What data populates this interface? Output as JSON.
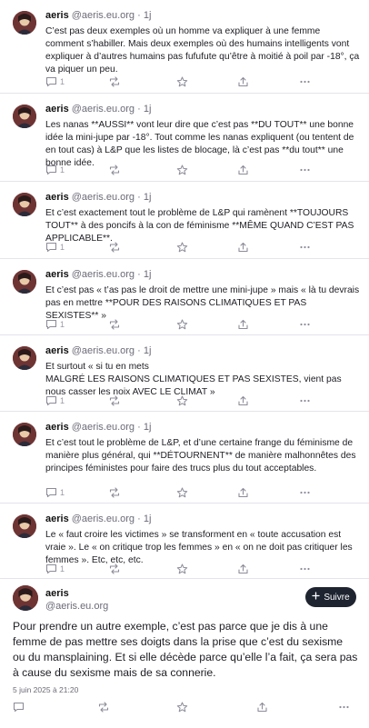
{
  "posts": [
    {
      "name": "aeris",
      "handle": "@aeris.eu.org",
      "dot": "·",
      "age": "1j",
      "text": "C’est pas deux exemples où un homme va expliquer à une femme comment s’habiller. Mais deux exemples où des humains intelligents vont expliquer à d’autres humains pas fufufute qu’être à moitié à poil par -18°, ça va piquer un peu.",
      "reply_count": "1"
    },
    {
      "name": "aeris",
      "handle": "@aeris.eu.org",
      "dot": "·",
      "age": "1j",
      "text": "Les nanas **AUSSI** vont leur dire que c’est pas **DU TOUT** une bonne idée la mini-jupe par -18°. Tout comme les nanas expliquent (ou tentent de en tout cas) à L&P que les listes de blocage, là c’est pas **du tout** une bonne idée.",
      "reply_count": "1"
    },
    {
      "name": "aeris",
      "handle": "@aeris.eu.org",
      "dot": "·",
      "age": "1j",
      "text": "Et c’est exactement tout le problème de L&P qui ramènent **TOUJOURS TOUT** à des poncifs à la con de féminisme **MÊME QUAND C’EST PAS APPLICABLE**.",
      "reply_count": "1"
    },
    {
      "name": "aeris",
      "handle": "@aeris.eu.org",
      "dot": "·",
      "age": "1j",
      "text": "Et c’est pas « t’as pas le droit de mettre une mini-jupe » mais « là tu devrais pas en mettre **POUR DES RAISONS CLIMATIQUES ET PAS SEXISTES** »",
      "reply_count": "1"
    },
    {
      "name": "aeris",
      "handle": "@aeris.eu.org",
      "dot": "·",
      "age": "1j",
      "text": "Et surtout « si tu en mets\nMALGRÉ LES RAISONS CLIMATIQUES ET PAS SEXISTES, vient pas nous casser les noix AVEC LE CLIMAT »",
      "reply_count": "1"
    },
    {
      "name": "aeris",
      "handle": "@aeris.eu.org",
      "dot": "·",
      "age": "1j",
      "text": "Et c’est tout le problème de L&P, et d’une certaine frange du féminisme de manière plus général, qui **DÉTOURNENT** de manière malhonnêtes des principes féministes pour faire des trucs plus du tout acceptables.",
      "reply_count": "1"
    },
    {
      "name": "aeris",
      "handle": "@aeris.eu.org",
      "dot": "·",
      "age": "1j",
      "text": "Le « faut croire les victimes » se transforment en « toute accusation est vraie ». Le « on critique trop les femmes » en « on ne doit pas critiquer les femmes ». Etc, etc, etc.",
      "reply_count": "1"
    }
  ],
  "detail": {
    "name": "aeris",
    "handle": "@aeris.eu.org",
    "follow_label": "Suivre",
    "text": "Pour prendre un autre exemple, c’est pas parce que je dis à une femme de pas mettre ses doigts dans la prise que c’est du sexisme ou du mansplaining. Et si elle décède parce qu’elle l’a fait, ça sera pas à cause du sexisme mais de sa connerie.",
    "date": "5 juin 2025 à 21:20"
  },
  "icons": {
    "reply": "reply-icon",
    "boost": "boost-icon",
    "favourite": "star-icon",
    "share": "share-icon",
    "more": "more-icon",
    "follow": "plus-icon"
  },
  "colors": {
    "follow_button": "#1e2430",
    "muted": "#8c8c99",
    "divider": "#e4e4ea"
  }
}
